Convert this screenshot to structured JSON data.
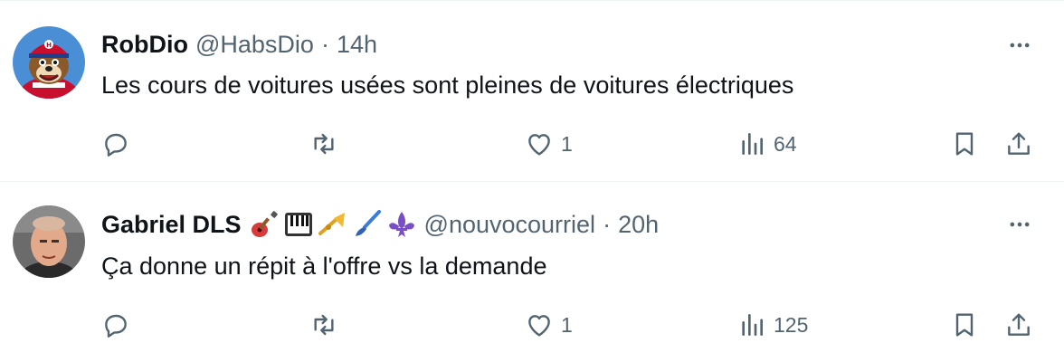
{
  "tweets": [
    {
      "name": "RobDio",
      "handle": "@HabsDio",
      "separator": "·",
      "time": "14h",
      "text": "Les cours de voitures usées sont pleines de voitures électriques",
      "likes": "1",
      "views": "64",
      "avatar_icon": "mascot-avatar"
    },
    {
      "name": "Gabriel DLS",
      "handle": "@nouvocourriel",
      "separator": "·",
      "time": "20h",
      "text": "Ça donne un répit à l'offre vs la demande",
      "likes": "1",
      "views": "125",
      "avatar_icon": "person-avatar",
      "name_emojis": [
        "guitar-icon",
        "piano-keys-icon",
        "trumpet-icon",
        "paintbrush-icon",
        "fleur-de-lis-icon"
      ]
    }
  ],
  "colors": {
    "text": "#0f1419",
    "secondary": "#536471",
    "divider": "#eff3f4"
  }
}
